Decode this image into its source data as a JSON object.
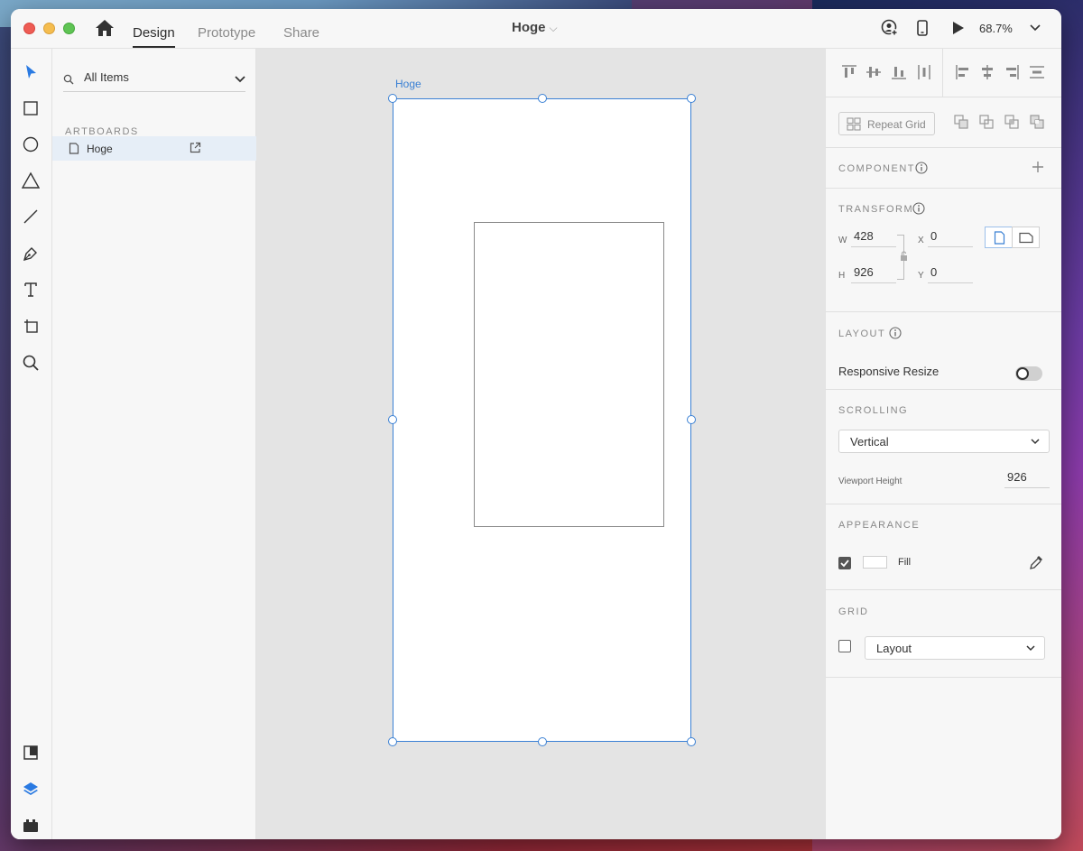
{
  "window": {
    "tabs": [
      {
        "label": "Design",
        "active": true
      },
      {
        "label": "Prototype",
        "active": false
      },
      {
        "label": "Share",
        "active": false
      }
    ],
    "document_title": "Hoge",
    "zoom": "68.7%"
  },
  "layers_panel": {
    "filter_label": "All Items",
    "section_title": "ARTBOARDS",
    "artboards": [
      "Hoge"
    ]
  },
  "canvas": {
    "artboard_name": "Hoge"
  },
  "inspector": {
    "repeat_grid_label": "Repeat Grid",
    "component": {
      "header": "COMPONENT"
    },
    "transform": {
      "header": "TRANSFORM",
      "w_label": "W",
      "w_value": "428",
      "h_label": "H",
      "h_value": "926",
      "x_label": "X",
      "x_value": "0",
      "y_label": "Y",
      "y_value": "0"
    },
    "layout": {
      "header": "LAYOUT",
      "responsive_resize_label": "Responsive Resize",
      "responsive_resize_on": false
    },
    "scrolling": {
      "header": "SCROLLING",
      "mode": "Vertical",
      "viewport_height_label": "Viewport Height",
      "viewport_height_value": "926"
    },
    "appearance": {
      "header": "APPEARANCE",
      "fill_label": "Fill",
      "fill_enabled": true,
      "fill_color": "#ffffff"
    },
    "grid": {
      "header": "GRID",
      "enabled": false,
      "type": "Layout"
    }
  },
  "colors": {
    "accent": "#3a80d4",
    "selected_row": "#e6eef7"
  }
}
